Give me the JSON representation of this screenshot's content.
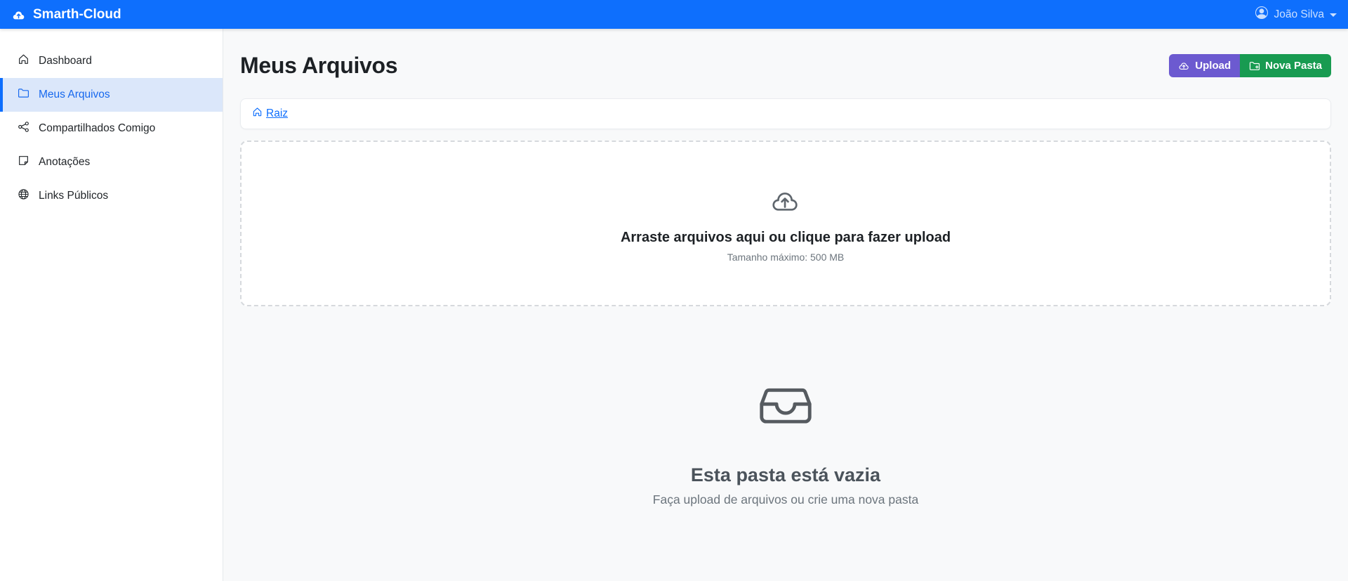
{
  "navbar": {
    "brand": "Smarth-Cloud",
    "brand_icon": "cloud-upload-icon",
    "user": {
      "name": "João Silva",
      "icon": "person-circle-icon",
      "caret": "caret-down-icon"
    }
  },
  "sidebar": {
    "items": [
      {
        "label": "Dashboard",
        "icon": "house-icon",
        "active": false
      },
      {
        "label": "Meus Arquivos",
        "icon": "folder-icon",
        "active": true
      },
      {
        "label": "Compartilhados Comigo",
        "icon": "share-icon",
        "active": false
      },
      {
        "label": "Anotações",
        "icon": "note-icon",
        "active": false
      },
      {
        "label": "Links Públicos",
        "icon": "globe-icon",
        "active": false
      }
    ]
  },
  "main": {
    "title": "Meus Arquivos",
    "actions": {
      "upload_label": "Upload",
      "upload_icon": "cloud-arrow-up-icon",
      "new_folder_label": "Nova Pasta",
      "new_folder_icon": "folder-plus-icon"
    },
    "breadcrumb": {
      "root_label": "Raiz",
      "root_icon": "house-icon"
    },
    "dropzone": {
      "icon": "cloud-arrow-up-icon",
      "title": "Arraste arquivos aqui ou clique para fazer upload",
      "subtitle": "Tamanho máximo: 500 MB"
    },
    "empty_state": {
      "icon": "inbox-icon",
      "title": "Esta pasta está vazia",
      "subtitle": "Faça upload de arquivos ou crie uma nova pasta"
    }
  },
  "colors": {
    "navbar_bg": "#0e6ffd",
    "accent_blue": "#0d6efd",
    "active_item_bg": "#dbe7fa",
    "upload_button": "#6c5ad0",
    "new_folder_button": "#189b51",
    "dropzone_border": "#d6d9dd",
    "muted_text": "#6c757d"
  }
}
